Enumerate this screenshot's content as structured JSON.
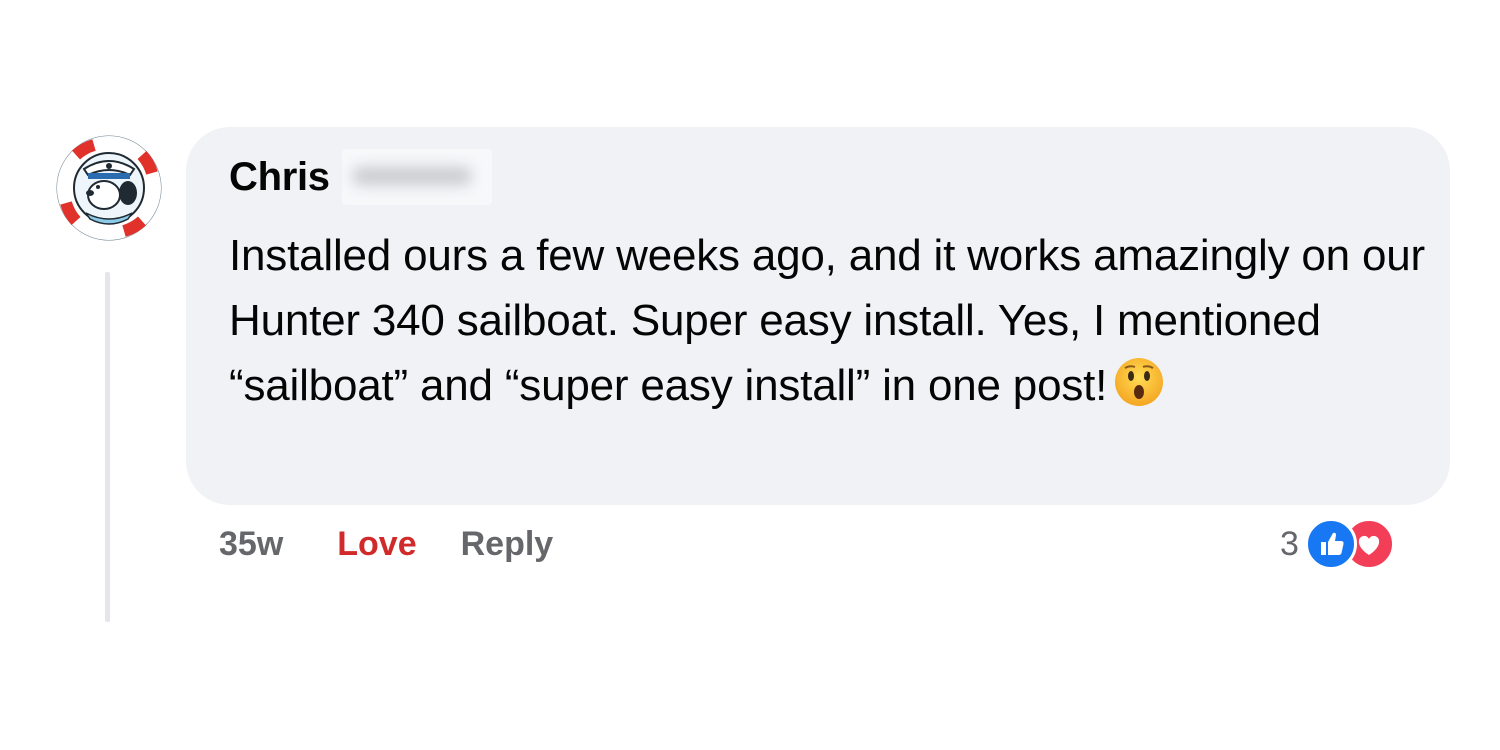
{
  "comment": {
    "author_first_name": "Chris",
    "body_text": "Installed ours a few weeks ago, and it works amazingly on our Hunter 340 sailboat. Super easy install. Yes, I mentioned “sailboat” and “super easy install” in one post!",
    "emoji": "hushed-face-emoji"
  },
  "actions": {
    "timestamp": "35w",
    "love_label": "Love",
    "reply_label": "Reply"
  },
  "reactions": {
    "count": "3",
    "icons": [
      "thumbs-up-icon",
      "heart-icon"
    ]
  },
  "colors": {
    "bubble": "#f0f2f5",
    "love_red": "#d12a2a",
    "like_blue": "#1877f2",
    "heart_red": "#f33e58",
    "muted_text": "#65676b"
  }
}
